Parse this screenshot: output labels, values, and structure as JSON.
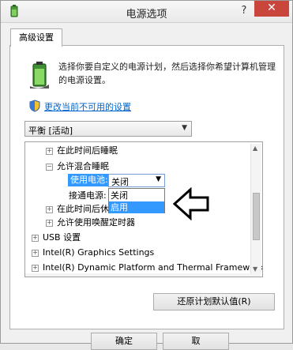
{
  "window": {
    "title": "电源选项",
    "help": "?",
    "close": "✕"
  },
  "tabs": [
    {
      "label": "高级设置"
    }
  ],
  "description": "选择你要自定义的电源计划，然后选择你希望计算机管理的电源设置。",
  "link_text": "更改当前不可用的设置",
  "plan_select": {
    "value": "平衡 [活动]"
  },
  "tree": {
    "rows": [
      {
        "prefix": "⊞",
        "label": "在此时间后睡眠"
      },
      {
        "prefix": "⊟",
        "label": "允许混合睡眠"
      },
      {
        "prefix": "",
        "label": "使用电池:"
      },
      {
        "prefix": "",
        "label": "接通电源:"
      },
      {
        "prefix": "⊞",
        "label": "在此时间后休"
      },
      {
        "prefix": "⊞",
        "label": "允许使用唤醒定时器"
      },
      {
        "prefix": "⊞",
        "label": "USB 设置"
      },
      {
        "prefix": "⊞",
        "label": "Intel(R) Graphics Settings"
      },
      {
        "prefix": "⊞",
        "label": "Intel(R) Dynamic Platform and Thermal Framework Se"
      }
    ],
    "battery_value": "关闭",
    "dropdown_options": [
      {
        "label": "关闭",
        "selected": false
      },
      {
        "label": "启用",
        "selected": true
      }
    ]
  },
  "buttons": {
    "restore": "还原计划默认值(R)",
    "ok": "确定",
    "cancel": "取"
  },
  "colors": {
    "selection": "#3399ff",
    "link": "#0066cc",
    "close": "#c9463d"
  }
}
